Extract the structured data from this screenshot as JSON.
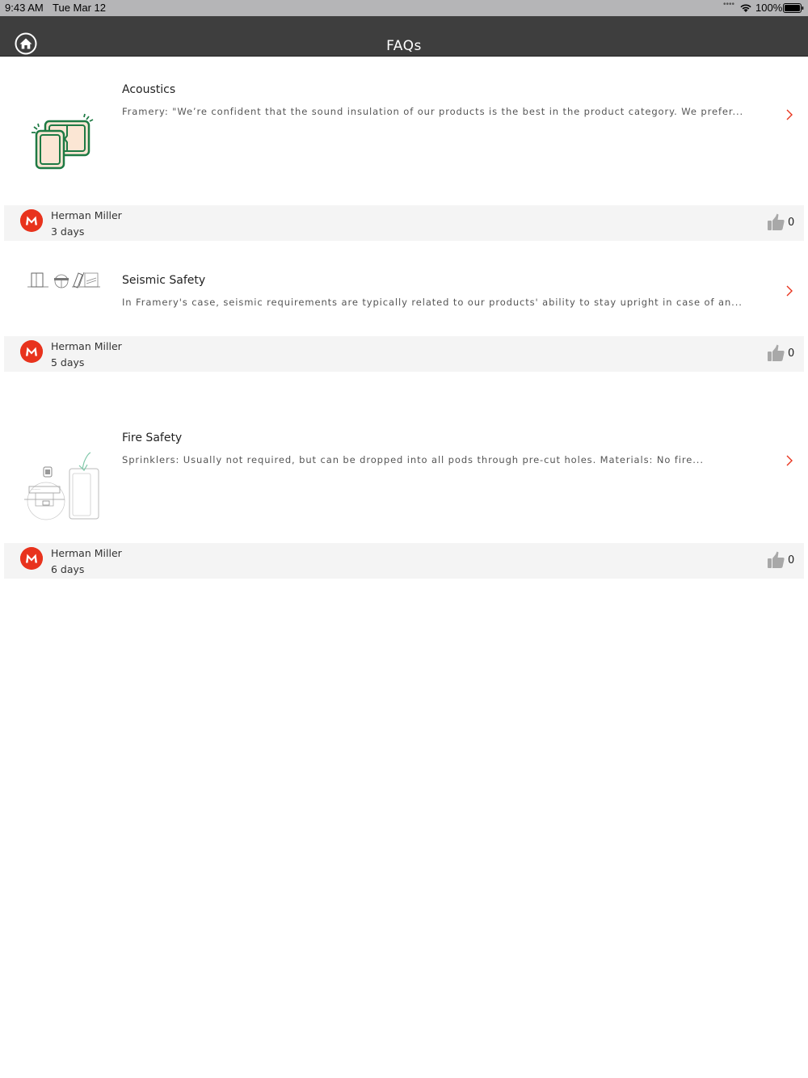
{
  "status_bar": {
    "time": "9:43 AM",
    "date": "Tue Mar 12",
    "signal_dots": "••••",
    "battery": "100%"
  },
  "nav": {
    "title": "FAQs",
    "home_icon": "home-icon"
  },
  "faqs": [
    {
      "title": "Acoustics",
      "excerpt": "Framery: \"We’re confident that the sound insulation of our products is the best in the product category. We prefer...",
      "author": "Herman Miller",
      "age": "3 days",
      "likes": "0",
      "thumbnail": "acoustic-panel-illustration"
    },
    {
      "title": "Seismic Safety",
      "excerpt": "In Framery's case, seismic requirements are typically related to our products' ability to stay upright in case of an...",
      "author": "Herman Miller",
      "age": "5 days",
      "likes": "0",
      "thumbnail": "seismic-diagram-illustration"
    },
    {
      "title": "Fire Safety",
      "excerpt": "Sprinklers: Usually not required, but can be dropped into all pods through pre-cut holes. Materials: No fire...",
      "author": "Herman Miller",
      "age": "6 days",
      "likes": "0",
      "thumbnail": "sprinkler-diagram-illustration"
    }
  ],
  "colors": {
    "nav_background": "#3e3e3e",
    "accent_red": "#e8331d",
    "meta_background": "#f4f4f4",
    "acoustics_green": "#1e7a44"
  }
}
